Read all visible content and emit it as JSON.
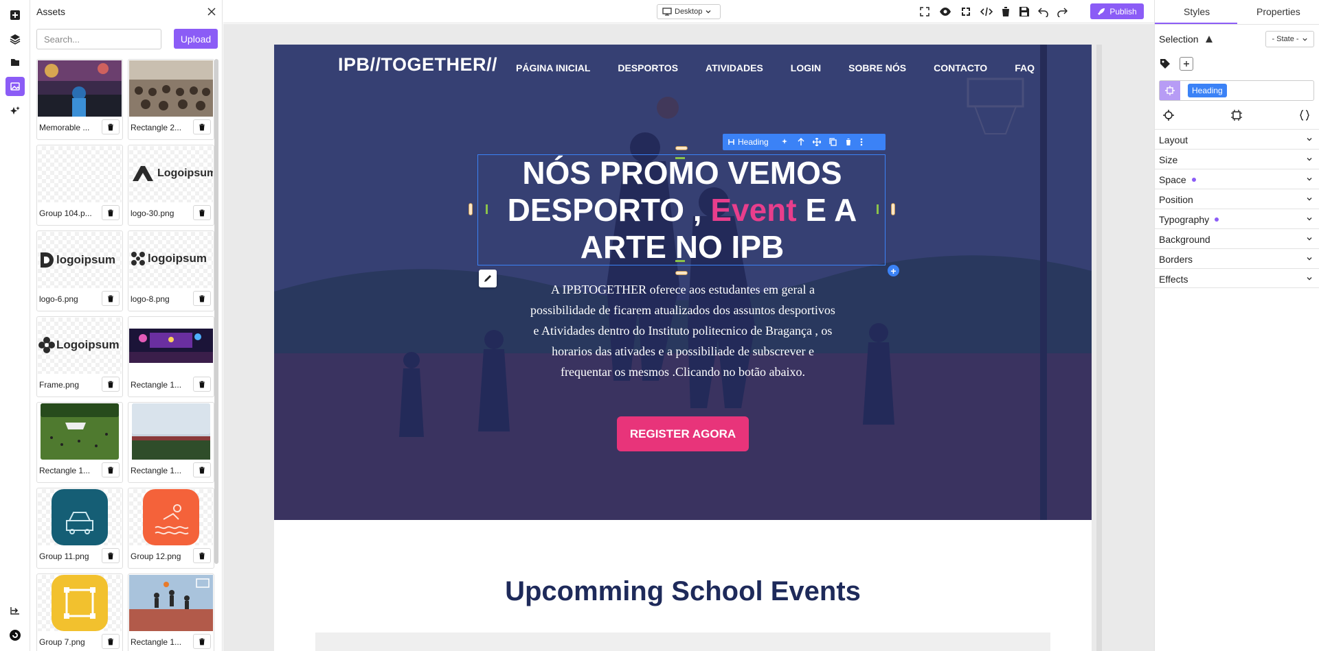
{
  "assets": {
    "title": "Assets",
    "search_placeholder": "Search...",
    "upload_label": "Upload",
    "items": [
      {
        "name": "Memorable ...",
        "kind": "photo-crowd"
      },
      {
        "name": "Rectangle 2...",
        "kind": "photo-audience"
      },
      {
        "name": "Group 104.p...",
        "kind": "blank"
      },
      {
        "name": "logo-30.png",
        "kind": "logo-a",
        "text": "Logoipsum"
      },
      {
        "name": "logo-6.png",
        "kind": "logo-d",
        "text": "logoipsum"
      },
      {
        "name": "logo-8.png",
        "kind": "logo-dots",
        "text": "logoipsum"
      },
      {
        "name": "Frame.png",
        "kind": "logo-flower",
        "text": "Logoipsum"
      },
      {
        "name": "Rectangle 1...",
        "kind": "photo-concert"
      },
      {
        "name": "Rectangle 1...",
        "kind": "photo-park"
      },
      {
        "name": "Rectangle 1...",
        "kind": "photo-sky"
      },
      {
        "name": "Group 11.png",
        "kind": "icon-teal"
      },
      {
        "name": "Group 12.png",
        "kind": "icon-orange"
      },
      {
        "name": "Group 7.png",
        "kind": "icon-yellow"
      },
      {
        "name": "Rectangle 1...",
        "kind": "photo-basket"
      }
    ]
  },
  "toolbar": {
    "device_label": "Desktop",
    "publish_label": "Publish"
  },
  "site": {
    "brand": "IPB//TOGETHER//",
    "nav": [
      "PÁGINA INICIAL",
      "DESPORTOS",
      "ATIVIDADES",
      "LOGIN",
      "SOBRE NÓS",
      "CONTACTO",
      "FAQ"
    ],
    "heading_part1": "NÓS PROMO VEMOS DESPORTO , ",
    "heading_accent": "Event",
    "heading_part2": " E A ARTE NO IPB",
    "paragraph": "A IPBTOGETHER oferece aos estudantes em geral a possibilidade de ficarem atualizados dos assuntos desportivos e Atividades dentro do Instituto politecnico de Bragança , os horarios das ativades e a possibiliade de subscrever e frequentar os mesmos .Clicando no botão abaixo.",
    "cta_label": "REGISTER AGORA",
    "events_title": "Upcomming School Events"
  },
  "selection_toolbar": {
    "label": "Heading"
  },
  "right_panel": {
    "tabs": [
      "Styles",
      "Properties"
    ],
    "active_tab": "Styles",
    "selection_label": "Selection",
    "state_label": "- State -",
    "class_chip": "Heading",
    "sections": [
      {
        "label": "Layout",
        "modified": false
      },
      {
        "label": "Size",
        "modified": false
      },
      {
        "label": "Space",
        "modified": true
      },
      {
        "label": "Position",
        "modified": false
      },
      {
        "label": "Typography",
        "modified": true
      },
      {
        "label": "Background",
        "modified": false
      },
      {
        "label": "Borders",
        "modified": false
      },
      {
        "label": "Effects",
        "modified": false
      }
    ]
  },
  "colors": {
    "accent": "#8b5cf6",
    "selection_blue": "#3b82f6",
    "hero_overlay": "#242c63",
    "heading_accent": "#e83e8c",
    "cta": "#e8347a",
    "events_title": "#1e2a5a"
  }
}
